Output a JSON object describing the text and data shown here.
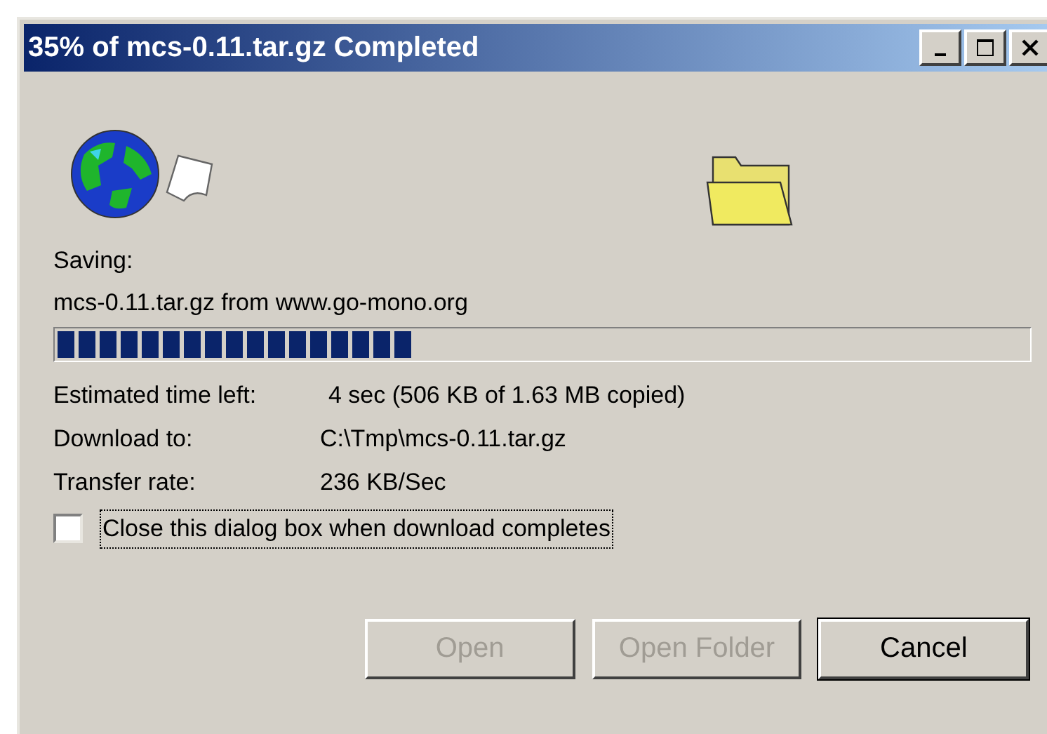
{
  "window": {
    "title": "35% of mcs-0.11.tar.gz Completed"
  },
  "title_buttons": [
    {
      "kind": "minimize"
    },
    {
      "kind": "maximize"
    },
    {
      "kind": "close"
    }
  ],
  "saving_label": "Saving:",
  "source": "mcs-0.11.tar.gz from www.go-mono.org",
  "progress": {
    "level": 0.37
  },
  "details": [
    {
      "label": "Estimated time left:",
      "value": "4 sec (506 KB of 1.63 MB copied)"
    },
    {
      "label": "Download to:",
      "value": "C:\\Tmp\\mcs-0.11.tar.gz"
    },
    {
      "label": "Transfer rate:",
      "value": "236 KB/Sec"
    }
  ],
  "close_checkbox": {
    "label": "Close this dialog box when download completes",
    "checked": false,
    "focused": true
  },
  "buttons": [
    {
      "label": "Open",
      "disabled": true,
      "default": false
    },
    {
      "label": "Open Folder",
      "disabled": true,
      "default": false
    },
    {
      "label": "Cancel",
      "disabled": false,
      "default": true
    }
  ]
}
